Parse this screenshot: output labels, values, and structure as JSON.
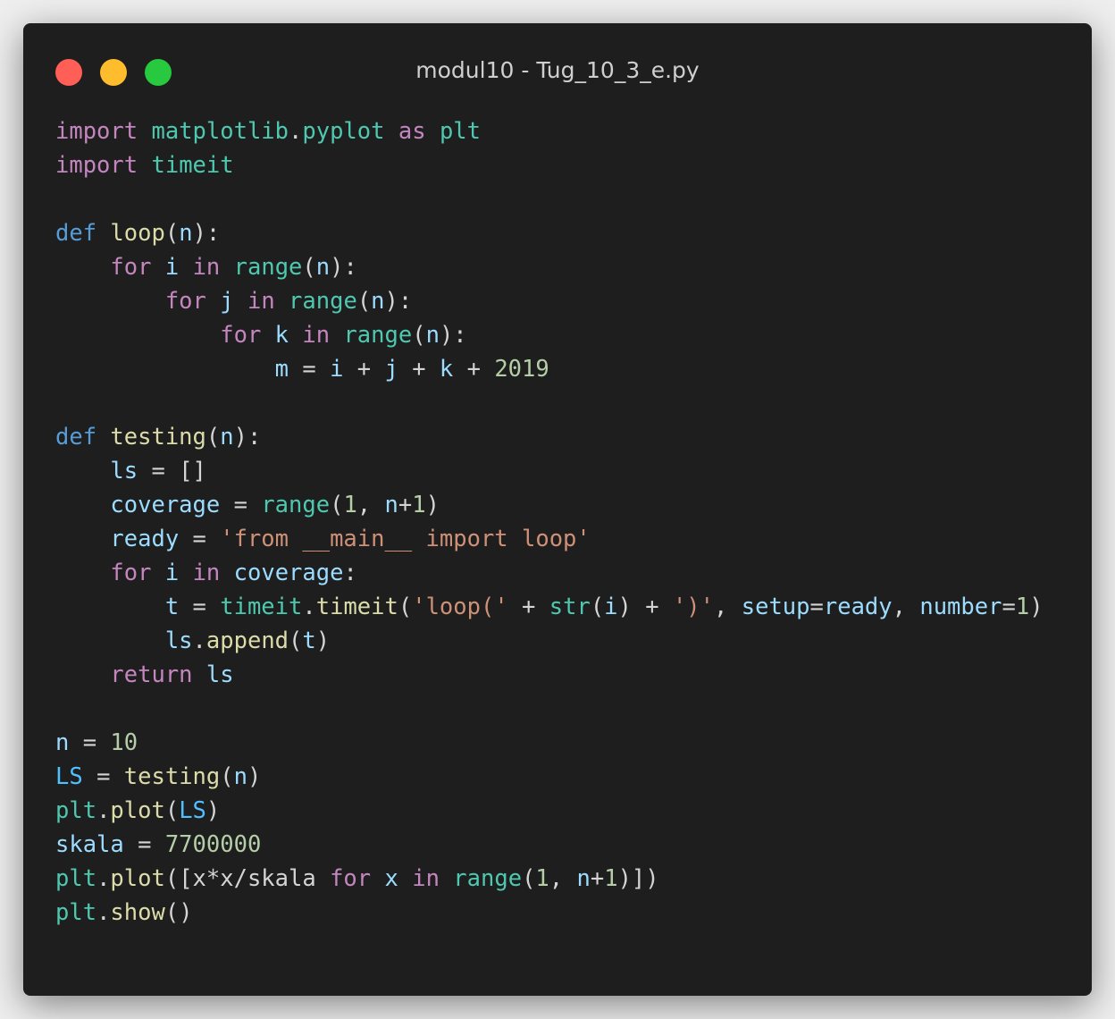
{
  "window": {
    "title": "modul10 - Tug_10_3_e.py"
  },
  "colors": {
    "background": "#1e1e1e",
    "close": "#ff5f56",
    "minimize": "#ffbd2e",
    "maximize": "#27c93f"
  },
  "code": {
    "language": "python",
    "lines": [
      [
        [
          "kw",
          "import"
        ],
        [
          "op",
          " "
        ],
        [
          "mod",
          "matplotlib"
        ],
        [
          "op",
          "."
        ],
        [
          "mod",
          "pyplot"
        ],
        [
          "op",
          " "
        ],
        [
          "kw",
          "as"
        ],
        [
          "op",
          " "
        ],
        [
          "mod",
          "plt"
        ]
      ],
      [
        [
          "kw",
          "import"
        ],
        [
          "op",
          " "
        ],
        [
          "mod",
          "timeit"
        ]
      ],
      [],
      [
        [
          "kwd",
          "def"
        ],
        [
          "op",
          " "
        ],
        [
          "fn",
          "loop"
        ],
        [
          "op",
          "("
        ],
        [
          "var",
          "n"
        ],
        [
          "op",
          "):"
        ]
      ],
      [
        [
          "op",
          "    "
        ],
        [
          "kw",
          "for"
        ],
        [
          "op",
          " "
        ],
        [
          "var",
          "i"
        ],
        [
          "op",
          " "
        ],
        [
          "kw",
          "in"
        ],
        [
          "op",
          " "
        ],
        [
          "mod",
          "range"
        ],
        [
          "op",
          "("
        ],
        [
          "var",
          "n"
        ],
        [
          "op",
          "):"
        ]
      ],
      [
        [
          "op",
          "        "
        ],
        [
          "kw",
          "for"
        ],
        [
          "op",
          " "
        ],
        [
          "var",
          "j"
        ],
        [
          "op",
          " "
        ],
        [
          "kw",
          "in"
        ],
        [
          "op",
          " "
        ],
        [
          "mod",
          "range"
        ],
        [
          "op",
          "("
        ],
        [
          "var",
          "n"
        ],
        [
          "op",
          "):"
        ]
      ],
      [
        [
          "op",
          "            "
        ],
        [
          "kw",
          "for"
        ],
        [
          "op",
          " "
        ],
        [
          "var",
          "k"
        ],
        [
          "op",
          " "
        ],
        [
          "kw",
          "in"
        ],
        [
          "op",
          " "
        ],
        [
          "mod",
          "range"
        ],
        [
          "op",
          "("
        ],
        [
          "var",
          "n"
        ],
        [
          "op",
          "):"
        ]
      ],
      [
        [
          "op",
          "                "
        ],
        [
          "var",
          "m"
        ],
        [
          "op",
          " = "
        ],
        [
          "var",
          "i"
        ],
        [
          "op",
          " + "
        ],
        [
          "var",
          "j"
        ],
        [
          "op",
          " + "
        ],
        [
          "var",
          "k"
        ],
        [
          "op",
          " + "
        ],
        [
          "num",
          "2019"
        ]
      ],
      [],
      [
        [
          "kwd",
          "def"
        ],
        [
          "op",
          " "
        ],
        [
          "fn",
          "testing"
        ],
        [
          "op",
          "("
        ],
        [
          "var",
          "n"
        ],
        [
          "op",
          "):"
        ]
      ],
      [
        [
          "op",
          "    "
        ],
        [
          "var",
          "ls"
        ],
        [
          "op",
          " = []"
        ]
      ],
      [
        [
          "op",
          "    "
        ],
        [
          "var",
          "coverage"
        ],
        [
          "op",
          " = "
        ],
        [
          "mod",
          "range"
        ],
        [
          "op",
          "("
        ],
        [
          "num",
          "1"
        ],
        [
          "op",
          ", "
        ],
        [
          "var",
          "n"
        ],
        [
          "op",
          "+"
        ],
        [
          "num",
          "1"
        ],
        [
          "op",
          ")"
        ]
      ],
      [
        [
          "op",
          "    "
        ],
        [
          "var",
          "ready"
        ],
        [
          "op",
          " = "
        ],
        [
          "str",
          "'from __main__ import loop'"
        ]
      ],
      [
        [
          "op",
          "    "
        ],
        [
          "kw",
          "for"
        ],
        [
          "op",
          " "
        ],
        [
          "var",
          "i"
        ],
        [
          "op",
          " "
        ],
        [
          "kw",
          "in"
        ],
        [
          "op",
          " "
        ],
        [
          "var",
          "coverage"
        ],
        [
          "op",
          ":"
        ]
      ],
      [
        [
          "op",
          "        "
        ],
        [
          "var",
          "t"
        ],
        [
          "op",
          " = "
        ],
        [
          "mod",
          "timeit"
        ],
        [
          "op",
          "."
        ],
        [
          "fn",
          "timeit"
        ],
        [
          "op",
          "("
        ],
        [
          "str",
          "'loop('"
        ],
        [
          "op",
          " + "
        ],
        [
          "mod",
          "str"
        ],
        [
          "op",
          "("
        ],
        [
          "var",
          "i"
        ],
        [
          "op",
          ") + "
        ],
        [
          "str",
          "')'"
        ],
        [
          "op",
          ", "
        ],
        [
          "var",
          "setup"
        ],
        [
          "op",
          "="
        ],
        [
          "var",
          "ready"
        ],
        [
          "op",
          ", "
        ],
        [
          "var",
          "number"
        ],
        [
          "op",
          "="
        ],
        [
          "num",
          "1"
        ],
        [
          "op",
          ")"
        ]
      ],
      [
        [
          "op",
          "        "
        ],
        [
          "var",
          "ls"
        ],
        [
          "op",
          "."
        ],
        [
          "fn",
          "append"
        ],
        [
          "op",
          "("
        ],
        [
          "var",
          "t"
        ],
        [
          "op",
          ")"
        ]
      ],
      [
        [
          "op",
          "    "
        ],
        [
          "kw",
          "return"
        ],
        [
          "op",
          " "
        ],
        [
          "var",
          "ls"
        ]
      ],
      [],
      [
        [
          "var",
          "n"
        ],
        [
          "op",
          " = "
        ],
        [
          "num",
          "10"
        ]
      ],
      [
        [
          "const",
          "LS"
        ],
        [
          "op",
          " = "
        ],
        [
          "fn",
          "testing"
        ],
        [
          "op",
          "("
        ],
        [
          "var",
          "n"
        ],
        [
          "op",
          ")"
        ]
      ],
      [
        [
          "mod",
          "plt"
        ],
        [
          "op",
          "."
        ],
        [
          "fn",
          "plot"
        ],
        [
          "op",
          "("
        ],
        [
          "const",
          "LS"
        ],
        [
          "op",
          ")"
        ]
      ],
      [
        [
          "var",
          "skala"
        ],
        [
          "op",
          " = "
        ],
        [
          "num",
          "7700000"
        ]
      ],
      [
        [
          "mod",
          "plt"
        ],
        [
          "op",
          "."
        ],
        [
          "fn",
          "plot"
        ],
        [
          "op",
          "([x*x/skala "
        ],
        [
          "kw",
          "for"
        ],
        [
          "op",
          " "
        ],
        [
          "var",
          "x"
        ],
        [
          "op",
          " "
        ],
        [
          "kw",
          "in"
        ],
        [
          "op",
          " "
        ],
        [
          "mod",
          "range"
        ],
        [
          "op",
          "("
        ],
        [
          "num",
          "1"
        ],
        [
          "op",
          ", "
        ],
        [
          "var",
          "n"
        ],
        [
          "op",
          "+"
        ],
        [
          "num",
          "1"
        ],
        [
          "op",
          ")])"
        ]
      ],
      [
        [
          "mod",
          "plt"
        ],
        [
          "op",
          "."
        ],
        [
          "fn",
          "show"
        ],
        [
          "op",
          "()"
        ]
      ]
    ]
  }
}
